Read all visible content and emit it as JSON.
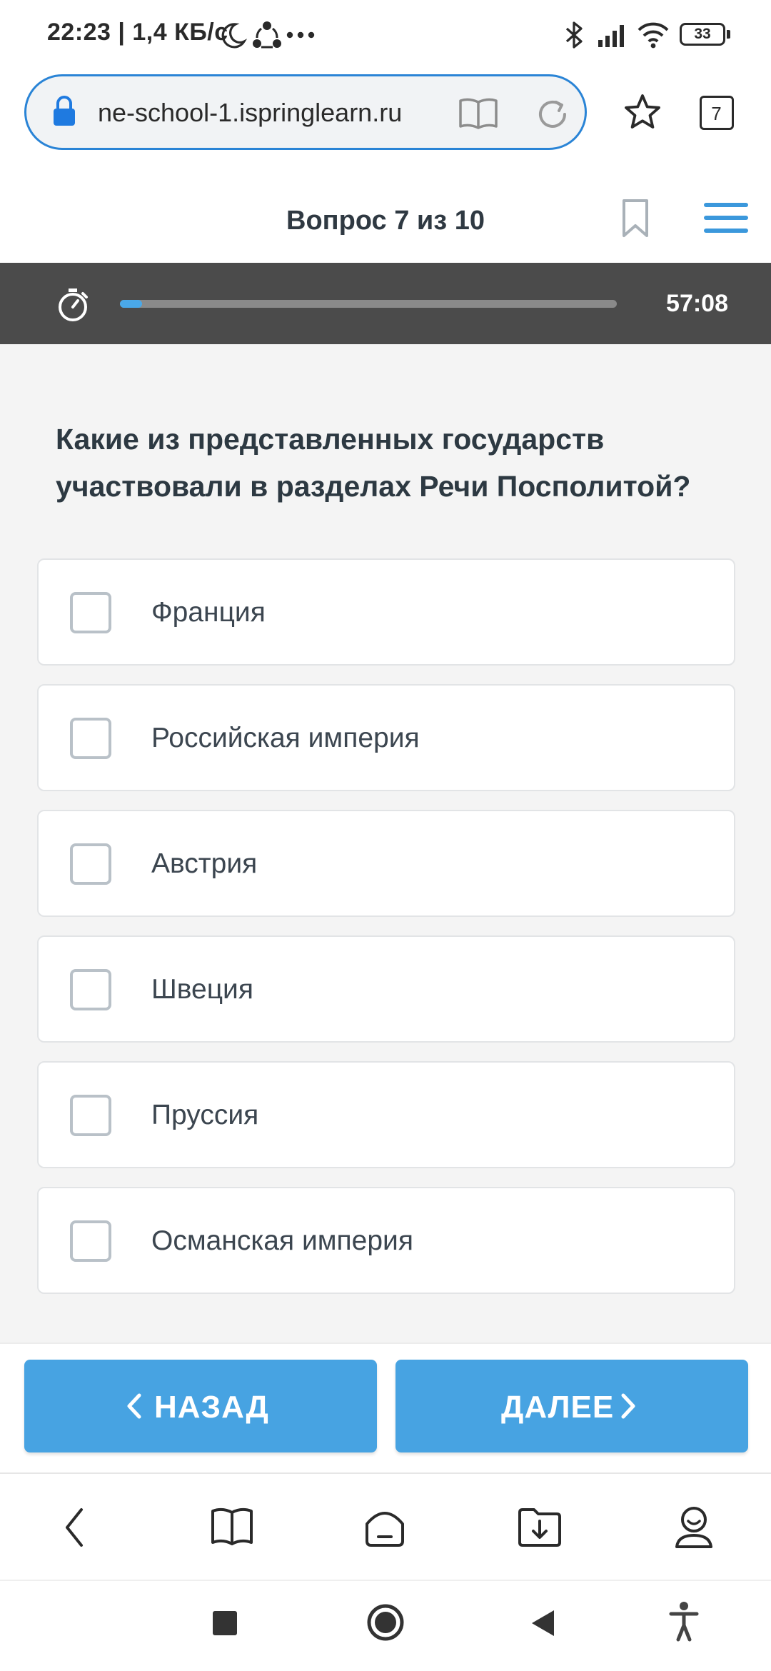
{
  "status_bar": {
    "time": "22:23",
    "network_speed": "1,4 КБ/с",
    "battery_level": "33"
  },
  "browser": {
    "url": "ne-school-1.ispringlearn.ru",
    "tab_count": "7"
  },
  "quiz": {
    "counter": "Вопрос 7 из 10",
    "timer": "57:08",
    "progress": 0.045,
    "question": "Какие из представленных государств участвовали в разделах Речи Посполитой?",
    "options": [
      {
        "label": "Франция",
        "checked": false
      },
      {
        "label": "Российская империя",
        "checked": false
      },
      {
        "label": "Австрия",
        "checked": false
      },
      {
        "label": "Швеция",
        "checked": false
      },
      {
        "label": "Пруссия",
        "checked": false
      },
      {
        "label": "Османская империя",
        "checked": false
      }
    ],
    "back_label": "НАЗАД",
    "next_label": "ДАЛЕЕ"
  },
  "colors": {
    "accent": "#47a3e2",
    "timer_bar": "#4b4b4b",
    "url_border": "#2a84d6"
  }
}
